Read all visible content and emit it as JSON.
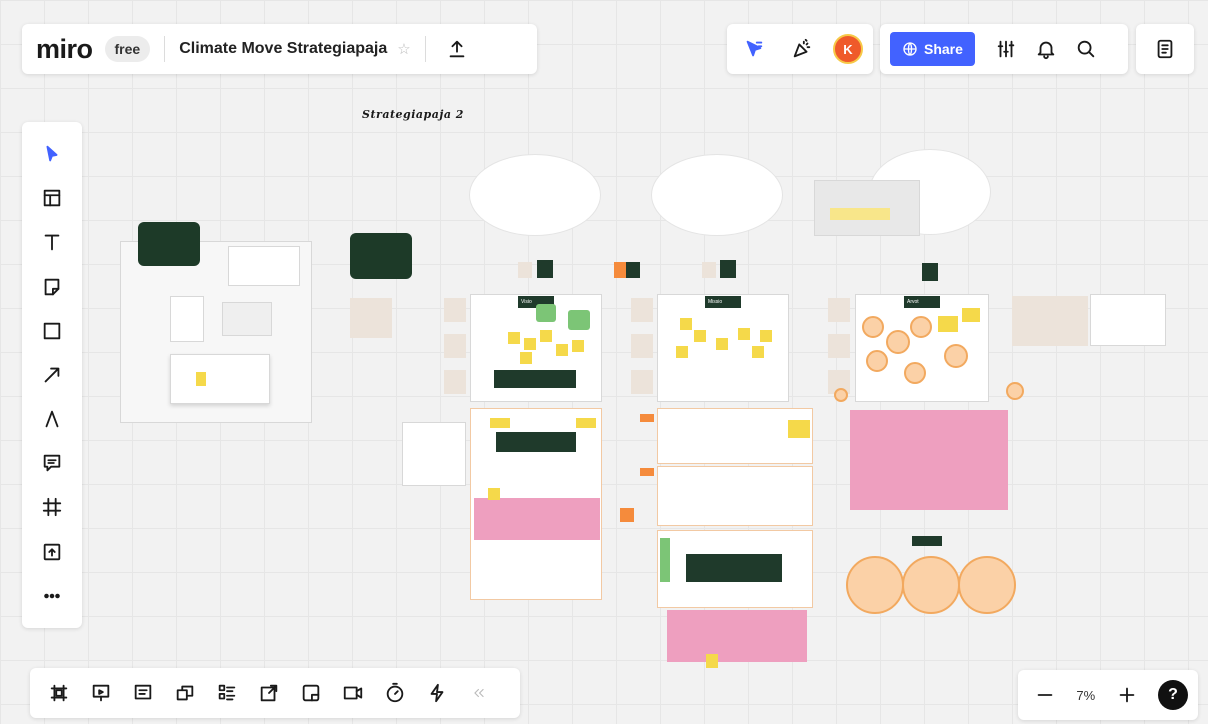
{
  "header": {
    "logo": "miro",
    "plan": "free",
    "board_title": "Climate Move Strategiapaja"
  },
  "share": {
    "label": "Share"
  },
  "user": {
    "avatar_initial": "K"
  },
  "canvas": {
    "title": "Strategiapaja 2",
    "frame_headings": [
      "Visio",
      "Missio",
      "Arvot"
    ]
  },
  "zoom": {
    "level": "7%"
  },
  "help": {
    "label": "?"
  },
  "colors": {
    "accent": "#4262ff",
    "avatar": "#ef5a2a",
    "sticky_yellow": "#f5d94a",
    "dark_green": "#1f3a2b",
    "pink": "#ee9fbf",
    "orange": "#f2a95f"
  }
}
